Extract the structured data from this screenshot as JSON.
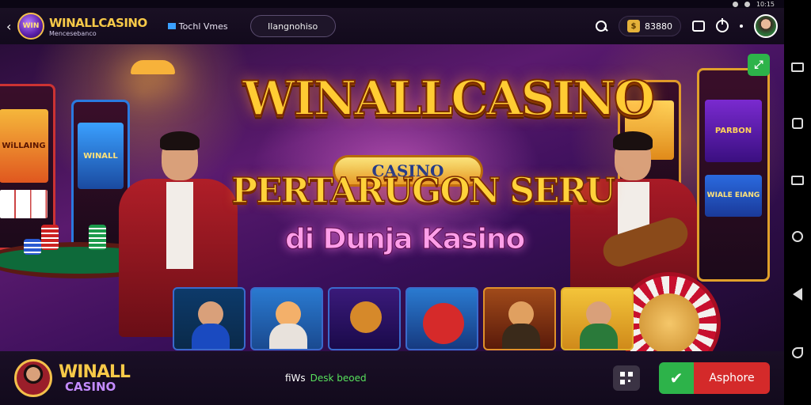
{
  "status_bar": {
    "time": "10:15"
  },
  "header": {
    "brand_name": "WINALLCASINO",
    "brand_sub": "Mencesebanco",
    "nav_link": "Tochl Vmes",
    "pill_button": "Ilangnohiso",
    "balance": "83880",
    "coin_glyph": "$"
  },
  "hero": {
    "title": "WINALLCASINO",
    "badge": "CASINO",
    "tagline": "PERTARUGON SERU",
    "tagline2": "di Dunja Kasino",
    "expand_glyph": "⤢",
    "left_slot_label": "WiLLAING",
    "center_slot_label": "WINALL",
    "right_slot_label": "PARBON",
    "right_slot_label2": "WIALE EIANG"
  },
  "bottom_bar": {
    "brand_line1": "WINALL",
    "brand_line2": "CASINO",
    "status_prefix": "fiWs",
    "status_accent": "Desk beoed",
    "cta_label": "Asphore",
    "cta_check": "✔"
  },
  "colors": {
    "accent_gold": "#f7c948",
    "cta_green": "#2db34a",
    "cta_red": "#d42a2a",
    "purple_bg": "#5a1a6e"
  }
}
